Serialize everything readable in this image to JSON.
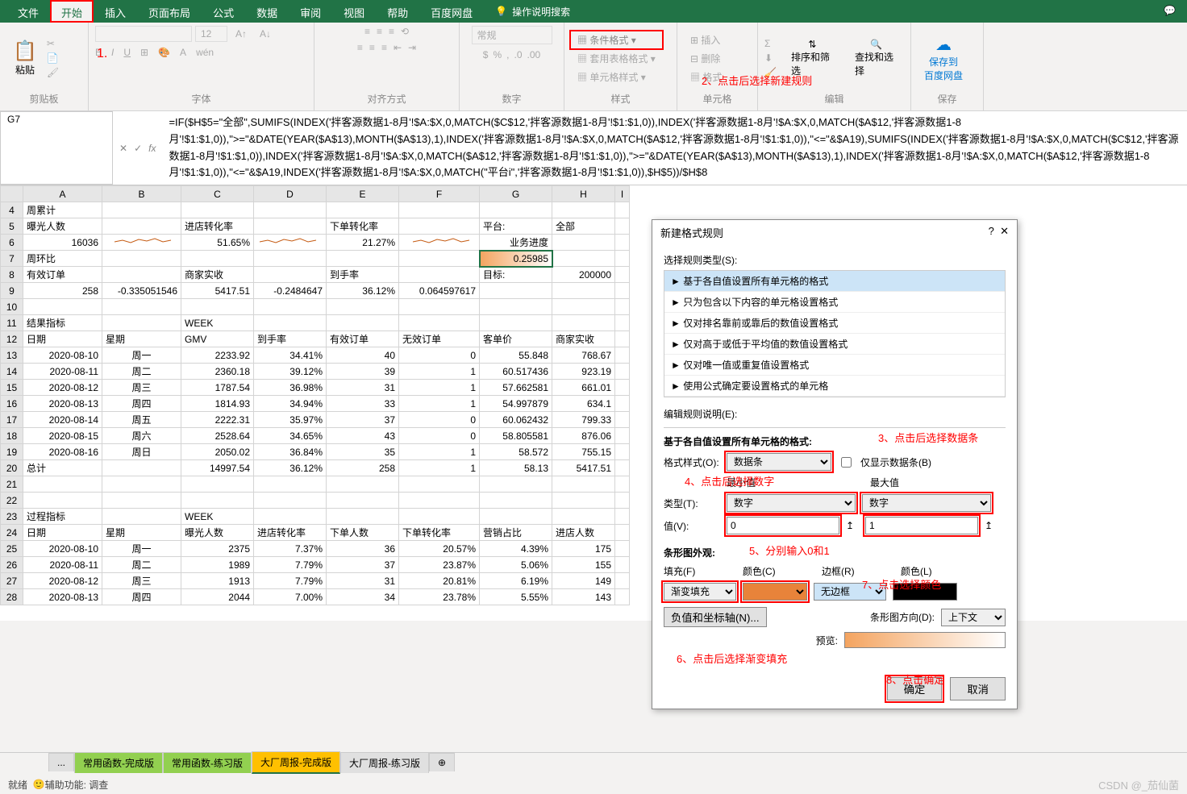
{
  "menu": {
    "file": "文件",
    "home": "开始",
    "insert": "插入",
    "layout": "页面布局",
    "formula": "公式",
    "data": "数据",
    "review": "审阅",
    "view": "视图",
    "help": "帮助",
    "baidu": "百度网盘",
    "search": "操作说明搜索"
  },
  "ribbon": {
    "clipboard": {
      "paste": "粘贴",
      "label": "剪贴板"
    },
    "font": {
      "label": "字体"
    },
    "align": {
      "label": "对齐方式",
      "general": "常规"
    },
    "number": {
      "label": "数字"
    },
    "styles": {
      "cond": "条件格式",
      "table": "套用表格格式",
      "cell": "单元格样式",
      "label": "样式"
    },
    "cells": {
      "insert": "插入",
      "delete": "删除",
      "format": "格式",
      "label": "单元格"
    },
    "edit": {
      "sort": "排序和筛选",
      "find": "查找和选择",
      "label": "编辑"
    },
    "save": {
      "btn": "保存到\n百度网盘",
      "label": "保存"
    }
  },
  "namebox": "G7",
  "formula": "=IF($H$5=\"全部\",SUMIFS(INDEX('拌客源数据1-8月'!$A:$X,0,MATCH($C$12,'拌客源数据1-8月'!$1:$1,0)),INDEX('拌客源数据1-8月'!$A:$X,0,MATCH($A$12,'拌客源数据1-8月'!$1:$1,0)),\">=\"&DATE(YEAR($A$13),MONTH($A$13),1),INDEX('拌客源数据1-8月'!$A:$X,0,MATCH($A$12,'拌客源数据1-8月'!$1:$1,0)),\"<=\"&$A19),SUMIFS(INDEX('拌客源数据1-8月'!$A:$X,0,MATCH($C$12,'拌客源数据1-8月'!$1:$1,0)),INDEX('拌客源数据1-8月'!$A:$X,0,MATCH($A$12,'拌客源数据1-8月'!$1:$1,0)),\">=\"&DATE(YEAR($A$13),MONTH($A$13),1),INDEX('拌客源数据1-8月'!$A:$X,0,MATCH($A$12,'拌客源数据1-8月'!$1:$1,0)),\"<=\"&$A19,INDEX('拌客源数据1-8月'!$A:$X,0,MATCH(\"平台i\",'拌客源数据1-8月'!$1:$1,0)),$H$5))/$H$8",
  "cols": [
    "A",
    "B",
    "C",
    "D",
    "E",
    "F",
    "G",
    "H",
    "I"
  ],
  "rows": [
    {
      "n": 4,
      "cells": [
        "周累计",
        "",
        "",
        "",
        "",
        "",
        "",
        "",
        ""
      ]
    },
    {
      "n": 5,
      "cells": [
        "曝光人数",
        "",
        "进店转化率",
        "",
        "下单转化率",
        "",
        "平台:",
        "全部",
        ""
      ]
    },
    {
      "n": 6,
      "cells": [
        "16036",
        "~",
        "51.65%",
        "~",
        "21.27%",
        "~",
        "业务进度",
        "",
        ""
      ]
    },
    {
      "n": 7,
      "cells": [
        "周环比",
        "",
        "",
        "",
        "",
        "",
        "0.25985",
        "",
        ""
      ]
    },
    {
      "n": 8,
      "cells": [
        "有效订单",
        "",
        "商家实收",
        "",
        "到手率",
        "",
        "目标:",
        "200000",
        ""
      ]
    },
    {
      "n": 9,
      "cells": [
        "258",
        "-0.335051546",
        "5417.51",
        "-0.2484647",
        "36.12%",
        "0.064597617",
        "",
        "",
        ""
      ]
    },
    {
      "n": 10,
      "cells": [
        "",
        "",
        "",
        "",
        "",
        "",
        "",
        "",
        ""
      ]
    },
    {
      "n": 11,
      "cells": [
        "结果指标",
        "",
        "WEEK",
        "",
        "",
        "",
        "",
        "",
        ""
      ]
    },
    {
      "n": 12,
      "cells": [
        "日期",
        "星期",
        "GMV",
        "到手率",
        "有效订单",
        "无效订单",
        "客单价",
        "商家实收",
        ""
      ]
    },
    {
      "n": 13,
      "cells": [
        "2020-08-10",
        "周一",
        "2233.92",
        "34.41%",
        "40",
        "0",
        "55.848",
        "768.67",
        ""
      ]
    },
    {
      "n": 14,
      "cells": [
        "2020-08-11",
        "周二",
        "2360.18",
        "39.12%",
        "39",
        "1",
        "60.517436",
        "923.19",
        ""
      ]
    },
    {
      "n": 15,
      "cells": [
        "2020-08-12",
        "周三",
        "1787.54",
        "36.98%",
        "31",
        "1",
        "57.662581",
        "661.01",
        ""
      ]
    },
    {
      "n": 16,
      "cells": [
        "2020-08-13",
        "周四",
        "1814.93",
        "34.94%",
        "33",
        "1",
        "54.997879",
        "634.1",
        ""
      ]
    },
    {
      "n": 17,
      "cells": [
        "2020-08-14",
        "周五",
        "2222.31",
        "35.97%",
        "37",
        "0",
        "60.062432",
        "799.33",
        ""
      ]
    },
    {
      "n": 18,
      "cells": [
        "2020-08-15",
        "周六",
        "2528.64",
        "34.65%",
        "43",
        "0",
        "58.805581",
        "876.06",
        ""
      ]
    },
    {
      "n": 19,
      "cells": [
        "2020-08-16",
        "周日",
        "2050.02",
        "36.84%",
        "35",
        "1",
        "58.572",
        "755.15",
        ""
      ]
    },
    {
      "n": 20,
      "cells": [
        "总计",
        "",
        "14997.54",
        "36.12%",
        "258",
        "1",
        "58.13",
        "5417.51",
        ""
      ]
    },
    {
      "n": 21,
      "cells": [
        "",
        "",
        "",
        "",
        "",
        "",
        "",
        "",
        ""
      ]
    },
    {
      "n": 22,
      "cells": [
        "",
        "",
        "",
        "",
        "",
        "",
        "",
        "",
        ""
      ]
    },
    {
      "n": 23,
      "cells": [
        "过程指标",
        "",
        "WEEK",
        "",
        "",
        "",
        "",
        "",
        ""
      ]
    },
    {
      "n": 24,
      "cells": [
        "日期",
        "星期",
        "曝光人数",
        "进店转化率",
        "下单人数",
        "下单转化率",
        "营销占比",
        "进店人数",
        ""
      ]
    },
    {
      "n": 25,
      "cells": [
        "2020-08-10",
        "周一",
        "2375",
        "7.37%",
        "36",
        "20.57%",
        "4.39%",
        "175",
        ""
      ]
    },
    {
      "n": 26,
      "cells": [
        "2020-08-11",
        "周二",
        "1989",
        "7.79%",
        "37",
        "23.87%",
        "5.06%",
        "155",
        ""
      ]
    },
    {
      "n": 27,
      "cells": [
        "2020-08-12",
        "周三",
        "1913",
        "7.79%",
        "31",
        "20.81%",
        "6.19%",
        "149",
        ""
      ]
    },
    {
      "n": 28,
      "cells": [
        "2020-08-13",
        "周四",
        "2044",
        "7.00%",
        "34",
        "23.78%",
        "5.55%",
        "143",
        ""
      ]
    }
  ],
  "leftAlignCols": {
    "5": [
      0,
      2,
      4,
      6,
      7
    ],
    "7": [
      0
    ],
    "8": [
      0,
      2,
      4,
      6
    ],
    "11": [
      0,
      2
    ],
    "12": [
      0,
      1,
      2,
      3,
      4,
      5,
      6,
      7
    ],
    "20": [
      0
    ],
    "23": [
      0,
      2
    ],
    "24": [
      0,
      1,
      2,
      3,
      4,
      5,
      6,
      7
    ]
  },
  "centerCols": {
    "13": [
      1
    ],
    "14": [
      1
    ],
    "15": [
      1
    ],
    "16": [
      1
    ],
    "17": [
      1
    ],
    "18": [
      1
    ],
    "19": [
      1
    ],
    "25": [
      1
    ],
    "26": [
      1
    ],
    "27": [
      1
    ],
    "28": [
      1
    ]
  },
  "sheets": [
    "...",
    "常用函数-完成版",
    "常用函数-练习版",
    "大厂周报-完成版",
    "大厂周报-练习版"
  ],
  "activeSheet": 3,
  "status": {
    "ready": "就绪",
    "acc": "辅助功能: 调查"
  },
  "watermark": "CSDN @_茄仙菌",
  "dialog": {
    "title": "新建格式规则",
    "selectRuleLabel": "选择规则类型(S):",
    "rules": [
      "基于各自值设置所有单元格的格式",
      "只为包含以下内容的单元格设置格式",
      "仅对排名靠前或靠后的数值设置格式",
      "仅对高于或低于平均值的数值设置格式",
      "仅对唯一值或重复值设置格式",
      "使用公式确定要设置格式的单元格"
    ],
    "editLabel": "编辑规则说明(E):",
    "basedOn": "基于各自值设置所有单元格的格式:",
    "formatStyle": "格式样式(O):",
    "formatStyleVal": "数据条",
    "showBarOnly": "仅显示数据条(B)",
    "minLabel": "最小值",
    "maxLabel": "最大值",
    "typeLabel": "类型(T):",
    "typeMin": "数字",
    "typeMax": "数字",
    "valueLabel": "值(V):",
    "valueMin": "0",
    "valueMax": "1",
    "barAppearance": "条形图外观:",
    "fillLabel": "填充(F)",
    "fillVal": "渐变填充",
    "colorLabel": "颜色(C)",
    "borderLabel": "边框(R)",
    "borderVal": "无边框",
    "colorLabel2": "颜色(L)",
    "negBtn": "负值和坐标轴(N)...",
    "barDirLabel": "条形图方向(D):",
    "barDirVal": "上下文",
    "previewLabel": "预览:",
    "ok": "确定",
    "cancel": "取消"
  },
  "annotations": {
    "a1": "1.",
    "a2": "2、点击后选择新建规则",
    "a3": "3、点击后选择数据条",
    "a4": "4、点击后选择数字",
    "a5": "5、分别输入0和1",
    "a6": "6、点击后选择渐变填充",
    "a7": "7、点击选择颜色",
    "a8": "8、点击确定"
  }
}
